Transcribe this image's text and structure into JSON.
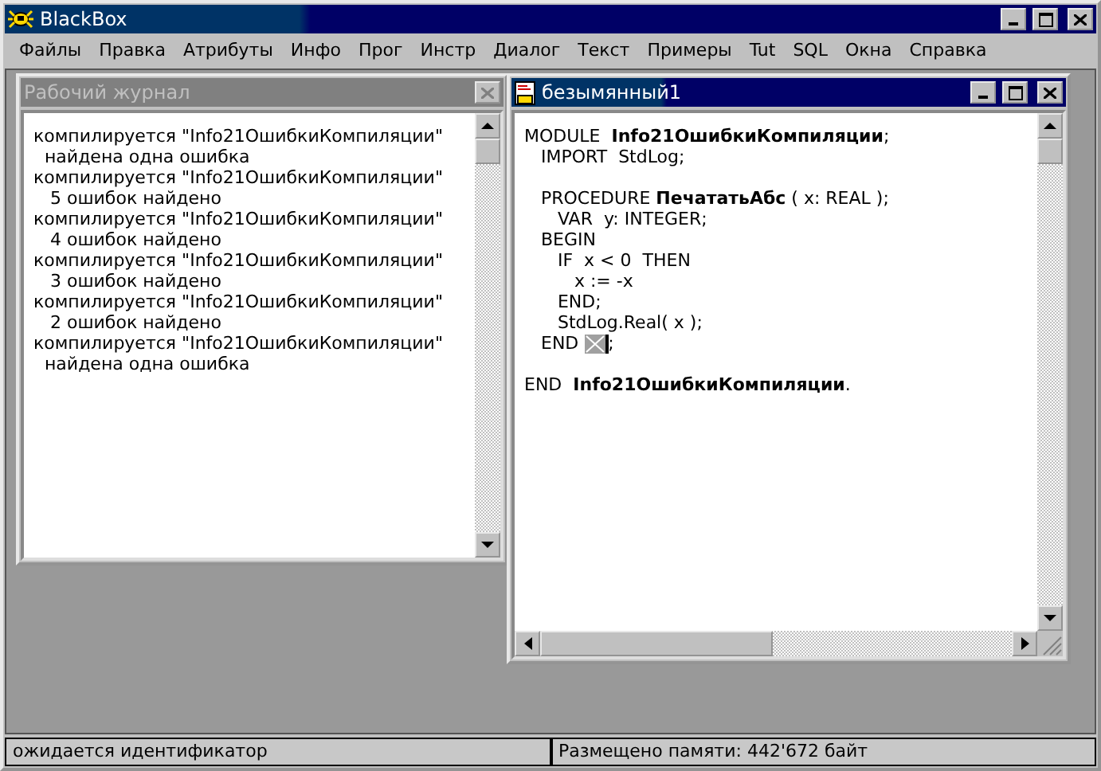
{
  "window": {
    "title": "BlackBox",
    "active": true
  },
  "menu": [
    "Файлы",
    "Правка",
    "Атрибуты",
    "Инфо",
    "Прог",
    "Инстр",
    "Диалог",
    "Текст",
    "Примеры",
    "Tut",
    "SQL",
    "Окна",
    "Справка"
  ],
  "log_window": {
    "title": "Рабочий журнал",
    "active": false,
    "lines": [
      "компилируется \"Info21ОшибкиКомпиляции\"",
      "  найдена одна ошибка",
      "компилируется \"Info21ОшибкиКомпиляции\"",
      "   5 ошибок найдено",
      "компилируется \"Info21ОшибкиКомпиляции\"",
      "   4 ошибок найдено",
      "компилируется \"Info21ОшибкиКомпиляции\"",
      "   3 ошибок найдено",
      "компилируется \"Info21ОшибкиКомпиляции\"",
      "   2 ошибок найдено",
      "компилируется \"Info21ОшибкиКомпиляции\"",
      "  найдена одна ошибка"
    ]
  },
  "editor_window": {
    "title": "безымянный1",
    "active": true,
    "lines": [
      {
        "text": "MODULE  **Info21ОшибкиКомпиляции**;"
      },
      {
        "text": "   IMPORT  StdLog;"
      },
      {
        "text": "   PROCEDURE **ПечататьАбс** ( x: REAL );",
        "blank_line_before": true
      },
      {
        "text": "      VAR  y: INTEGER;"
      },
      {
        "text": "   BEGIN"
      },
      {
        "text": "      IF  x < 0  THEN"
      },
      {
        "text": "         x := -x"
      },
      {
        "text": "      END;"
      },
      {
        "text": "      StdLog.Real( x );"
      },
      {
        "text": "   END ",
        "error_marker": true,
        "after": ";"
      },
      {
        "text": "END  **Info21ОшибкиКомпиляции**.",
        "blank_line_before": true
      }
    ]
  },
  "status_bar": {
    "message": "ожидается идентификатор",
    "memory": "Размещено памяти: 442'672 байт"
  }
}
